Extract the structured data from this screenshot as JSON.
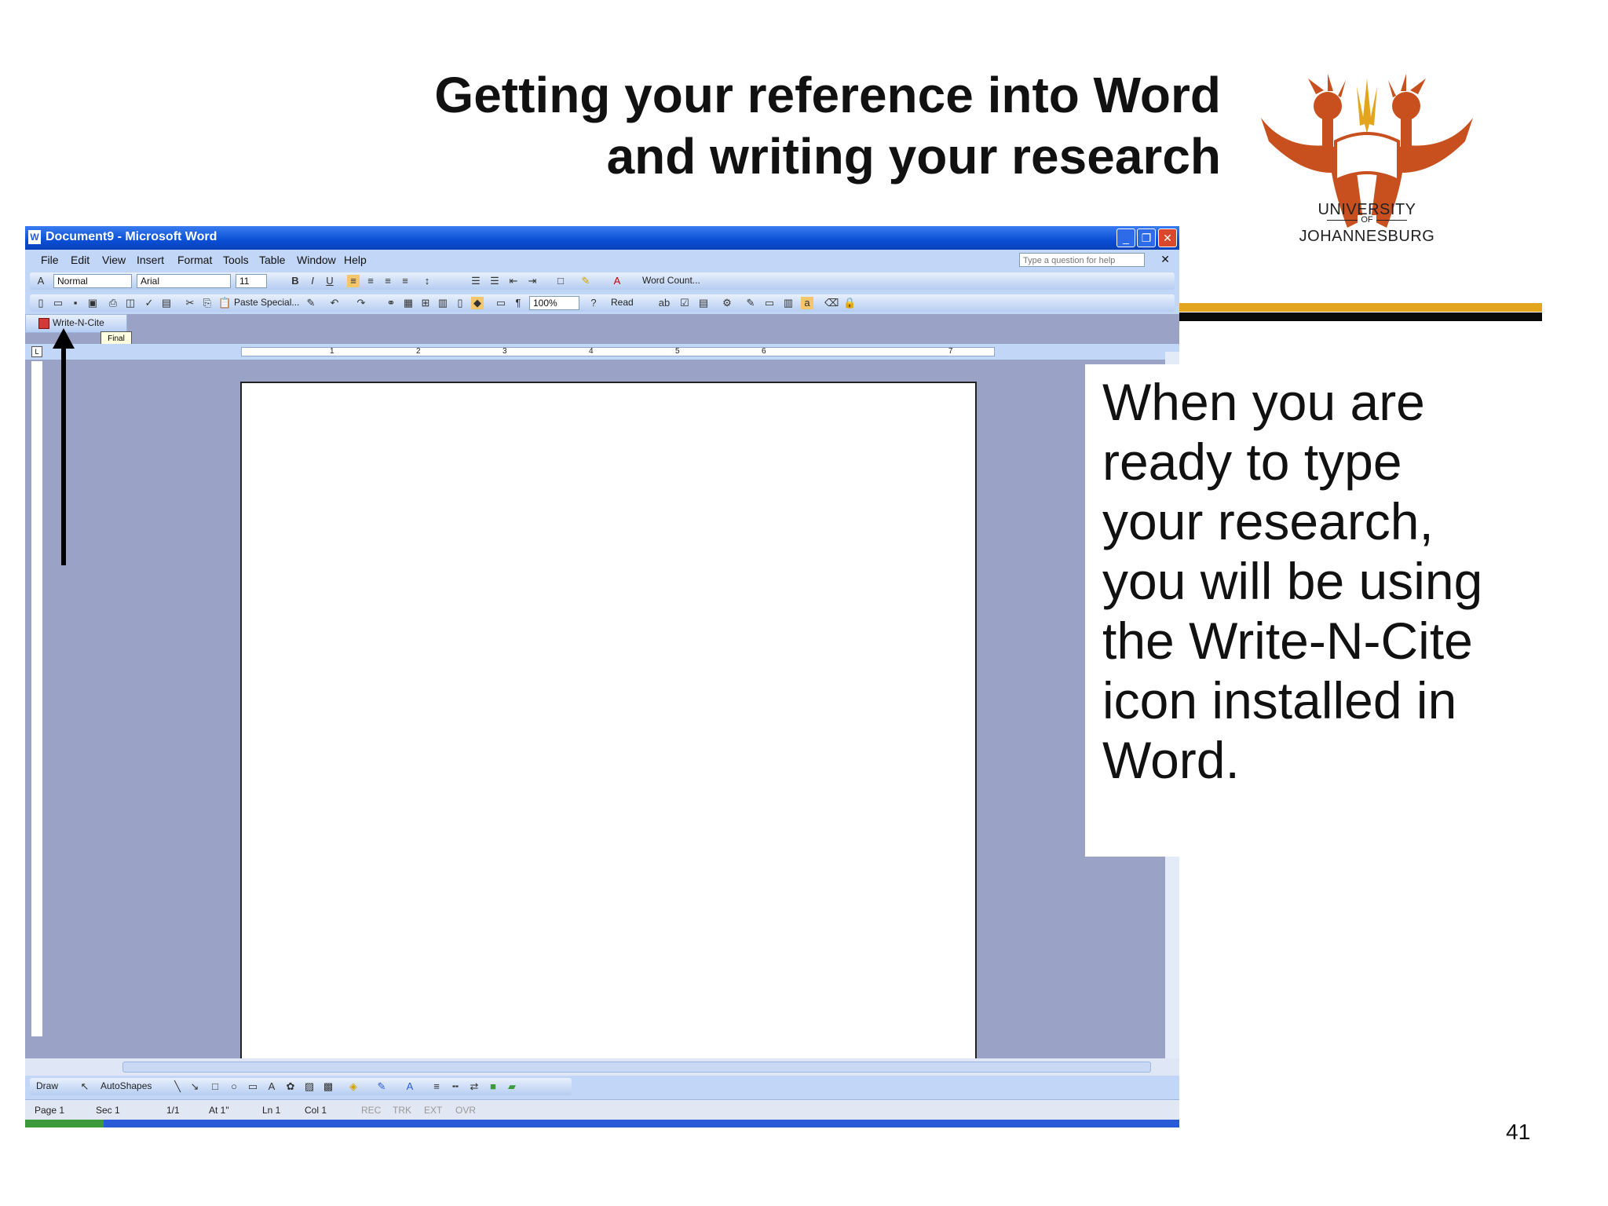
{
  "slide": {
    "title_line1": "Getting your reference into Word",
    "title_line2": "and writing your research",
    "body_text": "When you are ready to type your research, you will be using the Write-N-Cite icon installed in Word.",
    "page_number": "41"
  },
  "logo": {
    "line1": "UNIVERSITY",
    "line2": "OF",
    "line3": "JOHANNESBURG",
    "color": "#c8501e"
  },
  "colors": {
    "rule_gold": "#e3a41e",
    "rule_black": "#0a0a0a",
    "titlebar_blue": "#0a4fd6",
    "doc_area": "#9aa3c6"
  },
  "word": {
    "window_title": "Document9 - Microsoft Word",
    "menu": [
      "File",
      "Edit",
      "View",
      "Insert",
      "Format",
      "Tools",
      "Table",
      "Window",
      "Help"
    ],
    "help_placeholder": "Type a question for help",
    "style_value": "Normal",
    "font_value": "Arial",
    "size_value": "11",
    "word_count_label": "Word Count...",
    "paste_special_label": "Paste Special...",
    "zoom_value": "100%",
    "read_label": "Read",
    "write_n_cite_label": "Write-N-Cite",
    "tooltip_label": "Final",
    "draw_label": "Draw",
    "autoshapes_label": "AutoShapes",
    "status": {
      "page": "Page 1",
      "sec": "Sec 1",
      "pages": "1/1",
      "at": "At 1\"",
      "ln": "Ln 1",
      "col": "Col 1",
      "rec": "REC",
      "trk": "TRK",
      "ext": "EXT",
      "ovr": "OVR"
    },
    "ruler_numbers": [
      "1",
      "2",
      "3",
      "4",
      "5",
      "6",
      "7"
    ]
  }
}
